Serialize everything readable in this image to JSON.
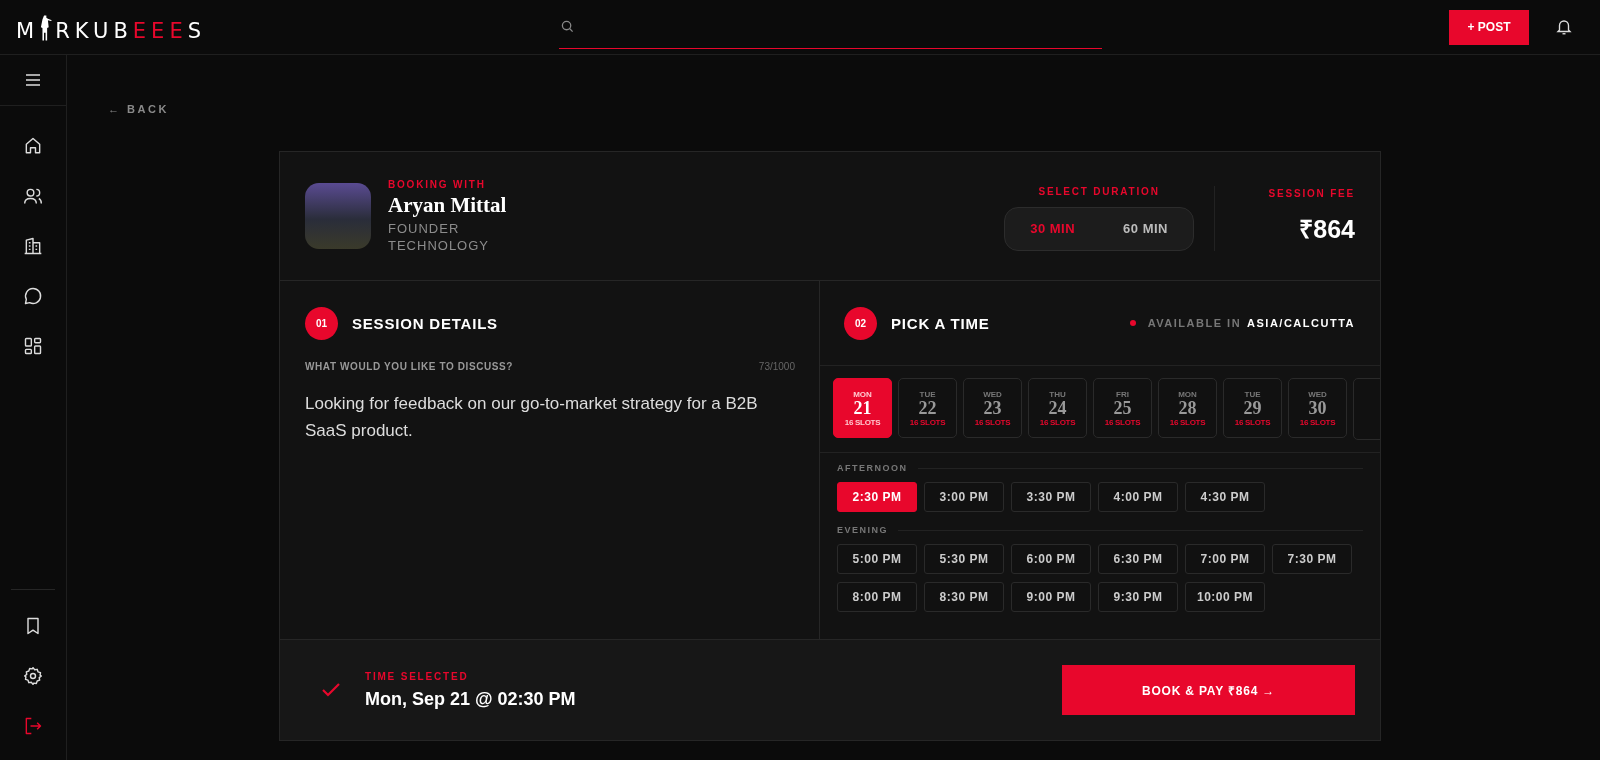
{
  "logo": {
    "lead": "M",
    "mid": "RKUB",
    "accent": "EEE",
    "tail": "S"
  },
  "header": {
    "post_button": "+ POST"
  },
  "back": "← BACK",
  "booking": {
    "label": "BOOKING WITH",
    "name": "Aryan Mittal",
    "role": "FOUNDER",
    "field": "TECHNOLOGY"
  },
  "duration": {
    "label": "SELECT DURATION",
    "options": [
      {
        "label": "30 MIN",
        "selected": true
      },
      {
        "label": "60 MIN",
        "selected": false
      }
    ]
  },
  "fee": {
    "label": "SESSION FEE",
    "amount": "₹864"
  },
  "session": {
    "step": "01",
    "title": "SESSION DETAILS",
    "question": "WHAT WOULD YOU LIKE TO DISCUSS?",
    "count": "73/1000",
    "value": "Looking for feedback on our go-to-market strategy for a B2B SaaS product."
  },
  "picker": {
    "step": "02",
    "title": "PICK A TIME",
    "availability_label": "AVAILABLE IN",
    "timezone": "ASIA/CALCUTTA",
    "dates": [
      {
        "day": "MON",
        "date": "21",
        "slots": "16 SLOTS",
        "selected": true
      },
      {
        "day": "TUE",
        "date": "22",
        "slots": "16 SLOTS",
        "selected": false
      },
      {
        "day": "WED",
        "date": "23",
        "slots": "16 SLOTS",
        "selected": false
      },
      {
        "day": "THU",
        "date": "24",
        "slots": "16 SLOTS",
        "selected": false
      },
      {
        "day": "FRI",
        "date": "25",
        "slots": "16 SLOTS",
        "selected": false
      },
      {
        "day": "MON",
        "date": "28",
        "slots": "16 SLOTS",
        "selected": false
      },
      {
        "day": "TUE",
        "date": "29",
        "slots": "16 SLOTS",
        "selected": false
      },
      {
        "day": "WED",
        "date": "30",
        "slots": "16 SLOTS",
        "selected": false
      }
    ],
    "groups": [
      {
        "label": "AFTERNOON",
        "slots": [
          {
            "time": "2:30 PM",
            "selected": true
          },
          {
            "time": "3:00 PM",
            "selected": false
          },
          {
            "time": "3:30 PM",
            "selected": false
          },
          {
            "time": "4:00 PM",
            "selected": false
          },
          {
            "time": "4:30 PM",
            "selected": false
          }
        ]
      },
      {
        "label": "EVENING",
        "slots": [
          {
            "time": "5:00 PM",
            "selected": false
          },
          {
            "time": "5:30 PM",
            "selected": false
          },
          {
            "time": "6:00 PM",
            "selected": false
          },
          {
            "time": "6:30 PM",
            "selected": false
          },
          {
            "time": "7:00 PM",
            "selected": false
          },
          {
            "time": "7:30 PM",
            "selected": false
          },
          {
            "time": "8:00 PM",
            "selected": false
          },
          {
            "time": "8:30 PM",
            "selected": false
          },
          {
            "time": "9:00 PM",
            "selected": false
          },
          {
            "time": "9:30 PM",
            "selected": false
          },
          {
            "time": "10:00 PM",
            "selected": false
          }
        ]
      }
    ]
  },
  "footer": {
    "label": "TIME SELECTED",
    "value": "Mon, Sep 21 @ 02:30 PM",
    "button": "BOOK & PAY ₹864 →"
  }
}
